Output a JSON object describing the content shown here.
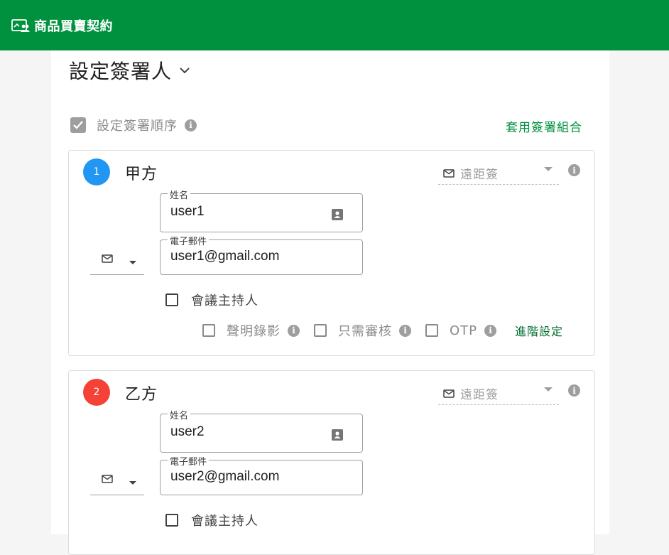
{
  "app": {
    "title": "商品買賣契約",
    "icon": "document-people-icon"
  },
  "section": {
    "title": "設定簽署人"
  },
  "signing_order": {
    "label": "設定簽署順序",
    "checked": true
  },
  "apply_group_link": "套用簽署組合",
  "signers": [
    {
      "index": "1",
      "badge_color": "#2196f3",
      "name": "甲方",
      "sign_type": "遠距簽",
      "name_field": {
        "label": "姓名",
        "value": "user1"
      },
      "email_field": {
        "label": "電子郵件",
        "value": "user1@gmail.com"
      },
      "host_label": "會議主持人",
      "options": [
        {
          "label": "聲明錄影"
        },
        {
          "label": "只需審核"
        },
        {
          "label": "OTP"
        }
      ],
      "advanced_label": "進階設定"
    },
    {
      "index": "2",
      "badge_color": "#f44336",
      "name": "乙方",
      "sign_type": "遠距簽",
      "name_field": {
        "label": "姓名",
        "value": "user2"
      },
      "email_field": {
        "label": "電子郵件",
        "value": "user2@gmail.com"
      },
      "host_label": "會議主持人"
    }
  ],
  "colors": {
    "brand": "#00913f",
    "link": "#00913f"
  }
}
